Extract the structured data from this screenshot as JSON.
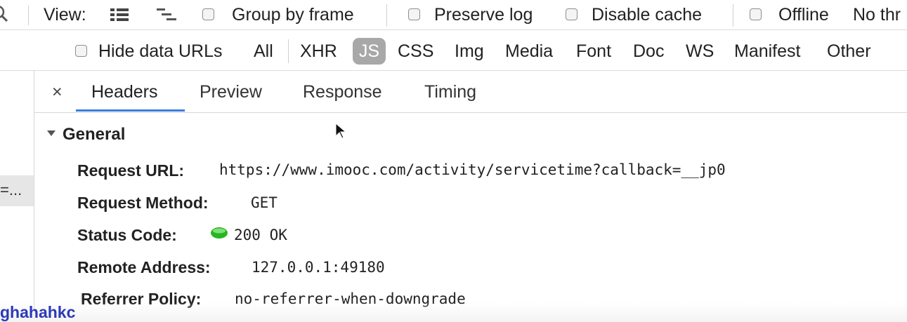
{
  "toolbar": {
    "view_label": "View:",
    "group_by_frame": "Group by frame",
    "preserve_log": "Preserve log",
    "disable_cache": "Disable cache",
    "offline": "Offline",
    "throttle": "No thr"
  },
  "filters": {
    "hide_data_urls": "Hide data URLs",
    "types": [
      "All",
      "XHR",
      "JS",
      "CSS",
      "Img",
      "Media",
      "Font",
      "Doc",
      "WS",
      "Manifest",
      "Other"
    ],
    "selected": "JS"
  },
  "left_panel": {
    "row_text": "=..."
  },
  "tabs": {
    "close": "×",
    "items": [
      "Headers",
      "Preview",
      "Response",
      "Timing"
    ],
    "active": "Headers"
  },
  "general": {
    "title": "General",
    "rows": [
      {
        "key": "Request URL:",
        "value": "https://www.imooc.com/activity/servicetime?callback=__jp0"
      },
      {
        "key": "Request Method:",
        "value": "GET"
      },
      {
        "key": "Status Code:",
        "value": "200 OK"
      },
      {
        "key": "Remote Address:",
        "value": "127.0.0.1:49180"
      },
      {
        "key": "Referrer Policy:",
        "value": "no-referrer-when-downgrade"
      }
    ],
    "status_color": "#28b523"
  },
  "overlay_text": "ghahahkc"
}
